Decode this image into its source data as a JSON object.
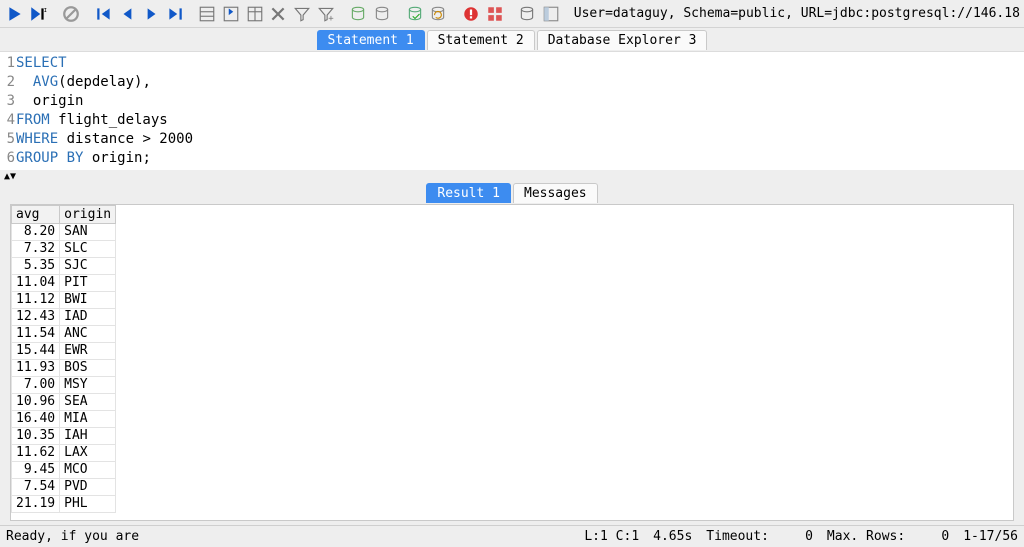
{
  "connection_info": "User=dataguy, Schema=public, URL=jdbc:postgresql://146.18",
  "tabs": [
    {
      "label": "Statement 1",
      "active": true
    },
    {
      "label": "Statement 2",
      "active": false
    },
    {
      "label": "Database Explorer 3",
      "active": false
    }
  ],
  "sql_lines": [
    [
      [
        "kw",
        "SELECT"
      ]
    ],
    [
      [
        "pl",
        "  "
      ],
      [
        "kw",
        "AVG"
      ],
      [
        "pl",
        "(depdelay),"
      ]
    ],
    [
      [
        "pl",
        "  origin"
      ]
    ],
    [
      [
        "kw",
        "FROM"
      ],
      [
        "pl",
        " flight_delays"
      ]
    ],
    [
      [
        "kw",
        "WHERE"
      ],
      [
        "pl",
        " distance > 2000"
      ]
    ],
    [
      [
        "kw",
        "GROUP BY"
      ],
      [
        "pl",
        " origin;"
      ]
    ]
  ],
  "result_tabs": [
    {
      "label": "Result 1",
      "active": true
    },
    {
      "label": "Messages",
      "active": false
    }
  ],
  "chart_data": {
    "type": "table",
    "columns": [
      "avg",
      "origin"
    ],
    "rows": [
      [
        "8.20",
        "SAN"
      ],
      [
        "7.32",
        "SLC"
      ],
      [
        "5.35",
        "SJC"
      ],
      [
        "11.04",
        "PIT"
      ],
      [
        "11.12",
        "BWI"
      ],
      [
        "12.43",
        "IAD"
      ],
      [
        "11.54",
        "ANC"
      ],
      [
        "15.44",
        "EWR"
      ],
      [
        "11.93",
        "BOS"
      ],
      [
        "7.00",
        "MSY"
      ],
      [
        "10.96",
        "SEA"
      ],
      [
        "16.40",
        "MIA"
      ],
      [
        "10.35",
        "IAH"
      ],
      [
        "11.62",
        "LAX"
      ],
      [
        "9.45",
        "MCO"
      ],
      [
        "7.54",
        "PVD"
      ],
      [
        "21.19",
        "PHL"
      ]
    ]
  },
  "status": {
    "message": "Ready, if you are",
    "cursor": "L:1 C:1",
    "time": "4.65s",
    "timeout_label": "Timeout:",
    "timeout_value": "0",
    "maxrows_label": "Max. Rows:",
    "maxrows_value": "0",
    "rowcount": "1-17/56"
  },
  "toolbar_icons": [
    "run-icon",
    "run-cursor-icon",
    "sep",
    "stop-icon",
    "sep",
    "first-icon",
    "prev-icon",
    "next-icon",
    "last-icon",
    "sep",
    "grid-icon",
    "insert-row-icon",
    "table-icon",
    "delete-icon",
    "filter-icon",
    "filter-add-icon",
    "sep",
    "db-open-icon",
    "db-icon",
    "sep",
    "db-save-icon",
    "db-refresh-icon",
    "sep",
    "alert-icon",
    "panes-icon",
    "sep",
    "db-console-icon",
    "layout-icon"
  ]
}
